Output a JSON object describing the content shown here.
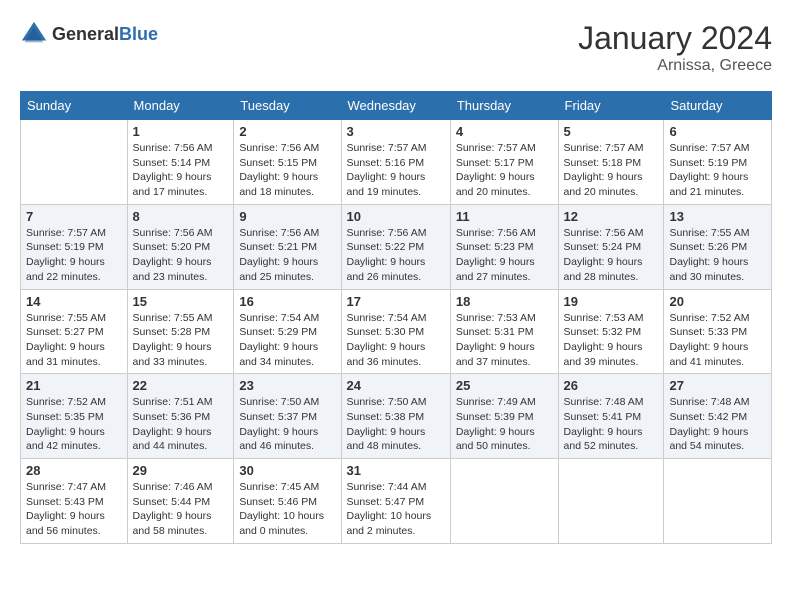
{
  "logo": {
    "general": "General",
    "blue": "Blue"
  },
  "title": "January 2024",
  "subtitle": "Arnissa, Greece",
  "days_of_week": [
    "Sunday",
    "Monday",
    "Tuesday",
    "Wednesday",
    "Thursday",
    "Friday",
    "Saturday"
  ],
  "weeks": [
    [
      {
        "day": "",
        "sunrise": "",
        "sunset": "",
        "daylight": ""
      },
      {
        "day": "1",
        "sunrise": "Sunrise: 7:56 AM",
        "sunset": "Sunset: 5:14 PM",
        "daylight": "Daylight: 9 hours and 17 minutes."
      },
      {
        "day": "2",
        "sunrise": "Sunrise: 7:56 AM",
        "sunset": "Sunset: 5:15 PM",
        "daylight": "Daylight: 9 hours and 18 minutes."
      },
      {
        "day": "3",
        "sunrise": "Sunrise: 7:57 AM",
        "sunset": "Sunset: 5:16 PM",
        "daylight": "Daylight: 9 hours and 19 minutes."
      },
      {
        "day": "4",
        "sunrise": "Sunrise: 7:57 AM",
        "sunset": "Sunset: 5:17 PM",
        "daylight": "Daylight: 9 hours and 20 minutes."
      },
      {
        "day": "5",
        "sunrise": "Sunrise: 7:57 AM",
        "sunset": "Sunset: 5:18 PM",
        "daylight": "Daylight: 9 hours and 20 minutes."
      },
      {
        "day": "6",
        "sunrise": "Sunrise: 7:57 AM",
        "sunset": "Sunset: 5:19 PM",
        "daylight": "Daylight: 9 hours and 21 minutes."
      }
    ],
    [
      {
        "day": "7",
        "sunrise": "Sunrise: 7:57 AM",
        "sunset": "Sunset: 5:19 PM",
        "daylight": "Daylight: 9 hours and 22 minutes."
      },
      {
        "day": "8",
        "sunrise": "Sunrise: 7:56 AM",
        "sunset": "Sunset: 5:20 PM",
        "daylight": "Daylight: 9 hours and 23 minutes."
      },
      {
        "day": "9",
        "sunrise": "Sunrise: 7:56 AM",
        "sunset": "Sunset: 5:21 PM",
        "daylight": "Daylight: 9 hours and 25 minutes."
      },
      {
        "day": "10",
        "sunrise": "Sunrise: 7:56 AM",
        "sunset": "Sunset: 5:22 PM",
        "daylight": "Daylight: 9 hours and 26 minutes."
      },
      {
        "day": "11",
        "sunrise": "Sunrise: 7:56 AM",
        "sunset": "Sunset: 5:23 PM",
        "daylight": "Daylight: 9 hours and 27 minutes."
      },
      {
        "day": "12",
        "sunrise": "Sunrise: 7:56 AM",
        "sunset": "Sunset: 5:24 PM",
        "daylight": "Daylight: 9 hours and 28 minutes."
      },
      {
        "day": "13",
        "sunrise": "Sunrise: 7:55 AM",
        "sunset": "Sunset: 5:26 PM",
        "daylight": "Daylight: 9 hours and 30 minutes."
      }
    ],
    [
      {
        "day": "14",
        "sunrise": "Sunrise: 7:55 AM",
        "sunset": "Sunset: 5:27 PM",
        "daylight": "Daylight: 9 hours and 31 minutes."
      },
      {
        "day": "15",
        "sunrise": "Sunrise: 7:55 AM",
        "sunset": "Sunset: 5:28 PM",
        "daylight": "Daylight: 9 hours and 33 minutes."
      },
      {
        "day": "16",
        "sunrise": "Sunrise: 7:54 AM",
        "sunset": "Sunset: 5:29 PM",
        "daylight": "Daylight: 9 hours and 34 minutes."
      },
      {
        "day": "17",
        "sunrise": "Sunrise: 7:54 AM",
        "sunset": "Sunset: 5:30 PM",
        "daylight": "Daylight: 9 hours and 36 minutes."
      },
      {
        "day": "18",
        "sunrise": "Sunrise: 7:53 AM",
        "sunset": "Sunset: 5:31 PM",
        "daylight": "Daylight: 9 hours and 37 minutes."
      },
      {
        "day": "19",
        "sunrise": "Sunrise: 7:53 AM",
        "sunset": "Sunset: 5:32 PM",
        "daylight": "Daylight: 9 hours and 39 minutes."
      },
      {
        "day": "20",
        "sunrise": "Sunrise: 7:52 AM",
        "sunset": "Sunset: 5:33 PM",
        "daylight": "Daylight: 9 hours and 41 minutes."
      }
    ],
    [
      {
        "day": "21",
        "sunrise": "Sunrise: 7:52 AM",
        "sunset": "Sunset: 5:35 PM",
        "daylight": "Daylight: 9 hours and 42 minutes."
      },
      {
        "day": "22",
        "sunrise": "Sunrise: 7:51 AM",
        "sunset": "Sunset: 5:36 PM",
        "daylight": "Daylight: 9 hours and 44 minutes."
      },
      {
        "day": "23",
        "sunrise": "Sunrise: 7:50 AM",
        "sunset": "Sunset: 5:37 PM",
        "daylight": "Daylight: 9 hours and 46 minutes."
      },
      {
        "day": "24",
        "sunrise": "Sunrise: 7:50 AM",
        "sunset": "Sunset: 5:38 PM",
        "daylight": "Daylight: 9 hours and 48 minutes."
      },
      {
        "day": "25",
        "sunrise": "Sunrise: 7:49 AM",
        "sunset": "Sunset: 5:39 PM",
        "daylight": "Daylight: 9 hours and 50 minutes."
      },
      {
        "day": "26",
        "sunrise": "Sunrise: 7:48 AM",
        "sunset": "Sunset: 5:41 PM",
        "daylight": "Daylight: 9 hours and 52 minutes."
      },
      {
        "day": "27",
        "sunrise": "Sunrise: 7:48 AM",
        "sunset": "Sunset: 5:42 PM",
        "daylight": "Daylight: 9 hours and 54 minutes."
      }
    ],
    [
      {
        "day": "28",
        "sunrise": "Sunrise: 7:47 AM",
        "sunset": "Sunset: 5:43 PM",
        "daylight": "Daylight: 9 hours and 56 minutes."
      },
      {
        "day": "29",
        "sunrise": "Sunrise: 7:46 AM",
        "sunset": "Sunset: 5:44 PM",
        "daylight": "Daylight: 9 hours and 58 minutes."
      },
      {
        "day": "30",
        "sunrise": "Sunrise: 7:45 AM",
        "sunset": "Sunset: 5:46 PM",
        "daylight": "Daylight: 10 hours and 0 minutes."
      },
      {
        "day": "31",
        "sunrise": "Sunrise: 7:44 AM",
        "sunset": "Sunset: 5:47 PM",
        "daylight": "Daylight: 10 hours and 2 minutes."
      },
      {
        "day": "",
        "sunrise": "",
        "sunset": "",
        "daylight": ""
      },
      {
        "day": "",
        "sunrise": "",
        "sunset": "",
        "daylight": ""
      },
      {
        "day": "",
        "sunrise": "",
        "sunset": "",
        "daylight": ""
      }
    ]
  ]
}
